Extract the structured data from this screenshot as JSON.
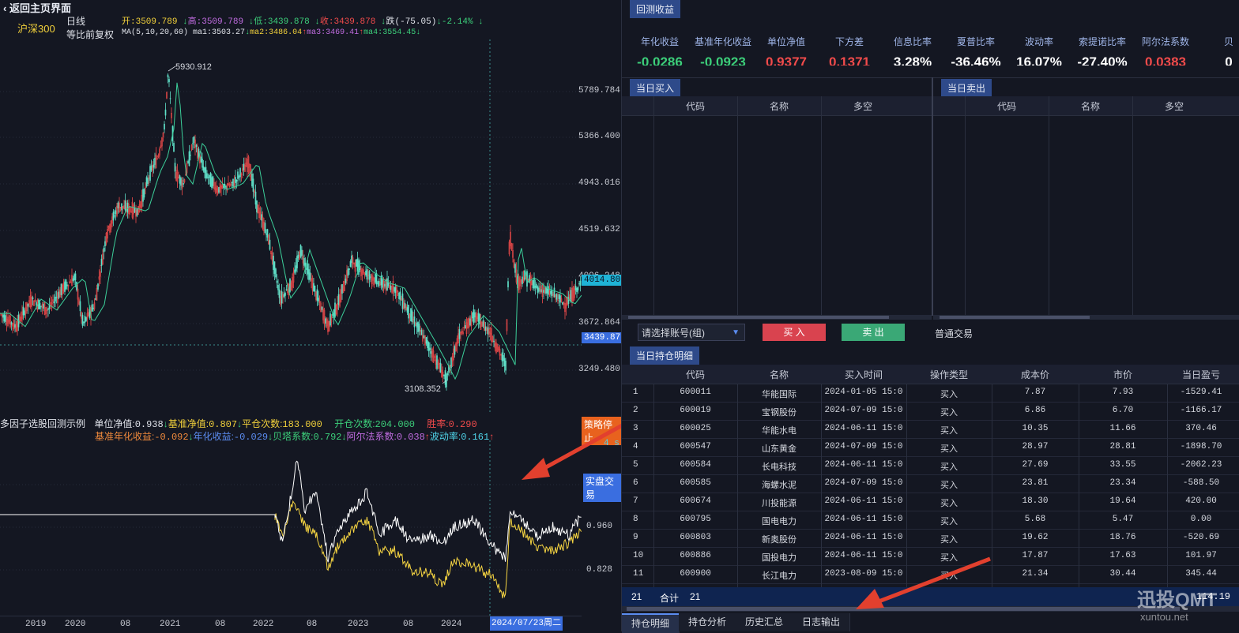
{
  "header": {
    "back_label": "返回主页界面",
    "index_name": "沪深300",
    "period": "日线",
    "adjust": "等比前复权",
    "open_label": "开:",
    "open_value": "3509.789",
    "high_label": "高:",
    "high_value": "3509.789",
    "low_label": "低:",
    "low_value": "3439.878",
    "close_label": "收:",
    "close_value": "3439.878",
    "change_text": "跌(-75.05)",
    "change_pct": "-2.14%",
    "ma_title": "MA(5,10,20,60)",
    "ma1_label": "ma1:",
    "ma1_value": "3503.27",
    "ma2_label": "ma2:",
    "ma2_value": "3486.04",
    "ma3_label": "ma3:",
    "ma3_value": "3469.41",
    "ma4_label": "ma4:",
    "ma4_value": "3554.45"
  },
  "kline": {
    "price_ticks": [
      "5789.784",
      "5366.400",
      "4943.016",
      "4519.632",
      "4096.248",
      "3672.864",
      "3249.480"
    ],
    "max_label": "5930.912",
    "min_label": "3108.352",
    "current_tag": "4014.807",
    "close_tag": "3439.878"
  },
  "oscillator": {
    "strategy_name": "多因子选股回测示例",
    "unit_nav_label": "单位净值:",
    "unit_nav_value": "0.938",
    "bench_nav_label": "基准净值:",
    "bench_nav_value": "0.807",
    "close_count_label": "平仓次数:",
    "close_count_value": "183.000",
    "open_count_label": "开仓次数:",
    "open_count_value": "204.000",
    "win_rate_label": "胜率:",
    "win_rate_value": "0.290",
    "bench_annual_label": "基准年化收益:",
    "bench_annual_value": "-0.092",
    "annual_label": "年化收益:",
    "annual_value": "-0.029",
    "beta_label": "贝塔系数:",
    "beta_value": "0.792",
    "alpha_label": "阿尔法系数:",
    "alpha_value": "0.038",
    "vol_label": "波动率:",
    "vol_value": "0.161",
    "stop_button": "策略停止",
    "timer": "4 s",
    "live_button": "实盘交易",
    "ticks": [
      "0.960",
      "0.828"
    ]
  },
  "x_axis": [
    "2019",
    "2020",
    "08",
    "2021",
    "08",
    "2022",
    "08",
    "2023",
    "08",
    "2024",
    "08"
  ],
  "cursor_date": "2024/07/23周二",
  "backtest": {
    "tab": "回测收益",
    "stats": [
      {
        "label": "年化收益",
        "value": "-0.0286",
        "color": "#3ccf7a"
      },
      {
        "label": "基准年化收益",
        "value": "-0.0923",
        "color": "#3ccf7a"
      },
      {
        "label": "单位净值",
        "value": "0.9377",
        "color": "#f24b4b"
      },
      {
        "label": "下方差",
        "value": "0.1371",
        "color": "#f24b4b"
      },
      {
        "label": "信息比率",
        "value": "3.28%",
        "color": "#ffffff"
      },
      {
        "label": "夏普比率",
        "value": "-36.46%",
        "color": "#ffffff"
      },
      {
        "label": "波动率",
        "value": "16.07%",
        "color": "#ffffff"
      },
      {
        "label": "索提诺比率",
        "value": "-27.40%",
        "color": "#ffffff"
      },
      {
        "label": "阿尔法系数",
        "value": "0.0383",
        "color": "#f24b4b"
      },
      {
        "label": "贝",
        "value": "0",
        "color": "#ffffff"
      }
    ]
  },
  "buy_today": {
    "tab": "当日买入",
    "columns": [
      "代码",
      "名称",
      "多空"
    ]
  },
  "sell_today": {
    "tab": "当日卖出",
    "columns": [
      "代码",
      "名称",
      "多空"
    ]
  },
  "trade_bar": {
    "account_placeholder": "请选择账号(组)",
    "buy_button": "买 入",
    "sell_button": "卖 出",
    "mode": "普通交易"
  },
  "positions": {
    "tab": "当日持仓明细",
    "columns": [
      "代码",
      "名称",
      "买入时间",
      "操作类型",
      "成本价",
      "市价",
      "当日盈亏"
    ],
    "rows": [
      {
        "idx": "1",
        "code": "600011",
        "name": "华能国际",
        "time": "2024-01-05 15:0",
        "op": "买入",
        "cost": "7.87",
        "price": "7.93",
        "pnl": "-1529.41"
      },
      {
        "idx": "2",
        "code": "600019",
        "name": "宝钢股份",
        "time": "2024-07-09 15:0",
        "op": "买入",
        "cost": "6.86",
        "price": "6.70",
        "pnl": "-1166.17"
      },
      {
        "idx": "3",
        "code": "600025",
        "name": "华能水电",
        "time": "2024-06-11 15:0",
        "op": "买入",
        "cost": "10.35",
        "price": "11.66",
        "pnl": "370.46"
      },
      {
        "idx": "4",
        "code": "600547",
        "name": "山东黄金",
        "time": "2024-07-09 15:0",
        "op": "买入",
        "cost": "28.97",
        "price": "28.81",
        "pnl": "-1898.70"
      },
      {
        "idx": "5",
        "code": "600584",
        "name": "长电科技",
        "time": "2024-06-11 15:0",
        "op": "买入",
        "cost": "27.69",
        "price": "33.55",
        "pnl": "-2062.23"
      },
      {
        "idx": "6",
        "code": "600585",
        "name": "海螺水泥",
        "time": "2024-07-09 15:0",
        "op": "买入",
        "cost": "23.81",
        "price": "23.34",
        "pnl": "-588.50"
      },
      {
        "idx": "7",
        "code": "600674",
        "name": "川投能源",
        "time": "2024-06-11 15:0",
        "op": "买入",
        "cost": "18.30",
        "price": "19.64",
        "pnl": "420.00"
      },
      {
        "idx": "8",
        "code": "600795",
        "name": "国电电力",
        "time": "2024-06-11 15:0",
        "op": "买入",
        "cost": "5.68",
        "price": "5.47",
        "pnl": "0.00"
      },
      {
        "idx": "9",
        "code": "600803",
        "name": "新奥股份",
        "time": "2024-06-11 15:0",
        "op": "买入",
        "cost": "19.62",
        "price": "18.76",
        "pnl": "-520.69"
      },
      {
        "idx": "10",
        "code": "600886",
        "name": "国投电力",
        "time": "2024-06-11 15:0",
        "op": "买入",
        "cost": "17.87",
        "price": "17.63",
        "pnl": "101.97"
      },
      {
        "idx": "11",
        "code": "600900",
        "name": "长江电力",
        "time": "2023-08-09 15:0",
        "op": "买入",
        "cost": "21.34",
        "price": "30.44",
        "pnl": "345.44"
      }
    ],
    "total_count": "21",
    "total_label": "合计",
    "total_value": "21",
    "total_pnl": "114.19"
  },
  "bottom_tabs": [
    "持仓明细",
    "持仓分析",
    "历史汇总",
    "日志输出"
  ],
  "watermark": "迅投QMT",
  "watermark_url": "xuntou.net",
  "colors": {
    "up": "#f24b4b",
    "down": "#3ccf7a",
    "accent": "#2e4a8a",
    "nav_line": "#ffffff",
    "bench_line": "#f5d442"
  }
}
